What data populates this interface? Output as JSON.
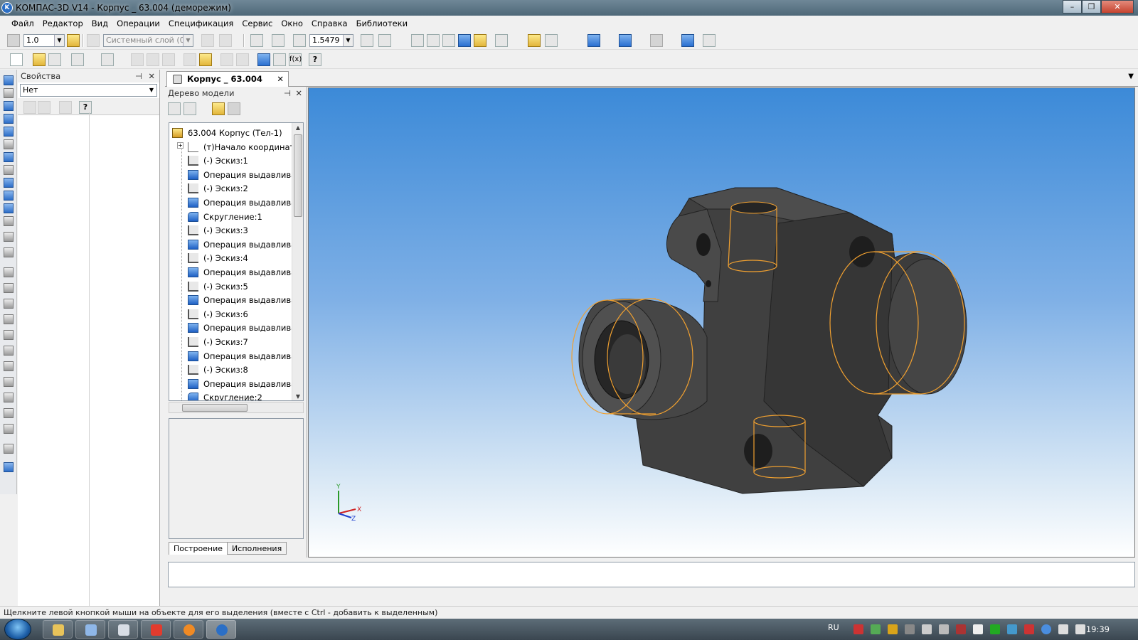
{
  "window": {
    "title": "КОМПАС-3D V14 - Корпус _ 63.004 (деморежим)",
    "app_icon": "kompas-logo-icon"
  },
  "menu": [
    "Файл",
    "Редактор",
    "Вид",
    "Операции",
    "Спецификация",
    "Сервис",
    "Окно",
    "Справка",
    "Библиотеки"
  ],
  "toolbar": {
    "step_value": "1.0",
    "layer_value": "Системный слой (0)",
    "zoom_value": "1.5479"
  },
  "properties_panel": {
    "title": "Свойства",
    "selection": "Нет"
  },
  "document_tab": {
    "label": "Корпус _ 63.004"
  },
  "tree_panel": {
    "title": "Дерево модели",
    "items": [
      {
        "label": "63.004 Корпус (Тел-1)",
        "icon": "part-root-icon"
      },
      {
        "label": "(т)Начало координат",
        "icon": "origin-icon"
      },
      {
        "label": "(-) Эскиз:1",
        "icon": "sketch-icon"
      },
      {
        "label": "Операция выдавливан",
        "icon": "extrude-icon"
      },
      {
        "label": "(-) Эскиз:2",
        "icon": "sketch-icon"
      },
      {
        "label": "Операция выдавливан",
        "icon": "extrude-icon"
      },
      {
        "label": "Скругление:1",
        "icon": "fillet-icon"
      },
      {
        "label": "(-) Эскиз:3",
        "icon": "sketch-icon"
      },
      {
        "label": "Операция выдавливан",
        "icon": "extrude-icon"
      },
      {
        "label": "(-) Эскиз:4",
        "icon": "sketch-icon"
      },
      {
        "label": "Операция выдавливан",
        "icon": "extrude-icon"
      },
      {
        "label": "(-) Эскиз:5",
        "icon": "sketch-icon"
      },
      {
        "label": "Операция выдавливан",
        "icon": "extrude-icon"
      },
      {
        "label": "(-) Эскиз:6",
        "icon": "sketch-icon"
      },
      {
        "label": "Операция выдавливан",
        "icon": "extrude-icon"
      },
      {
        "label": "(-) Эскиз:7",
        "icon": "sketch-icon"
      },
      {
        "label": "Операция выдавливан",
        "icon": "extrude-icon"
      },
      {
        "label": "(-) Эскиз:8",
        "icon": "sketch-icon"
      },
      {
        "label": "Операция выдавливан",
        "icon": "extrude-icon"
      },
      {
        "label": "Скругление:2",
        "icon": "fillet-icon"
      }
    ],
    "tabs": [
      "Построение",
      "Исполнения"
    ]
  },
  "viewport": {
    "axis_x": "X",
    "axis_y": "Y",
    "axis_z": "Z",
    "model_color": "#3f3f3f",
    "edge_color": "#f0a030"
  },
  "status_text": "Щелкните левой кнопкой мыши на объекте для его выделения (вместе с Ctrl - добавить к выделенным)",
  "taskbar": {
    "language": "RU",
    "clock": "19:39"
  }
}
